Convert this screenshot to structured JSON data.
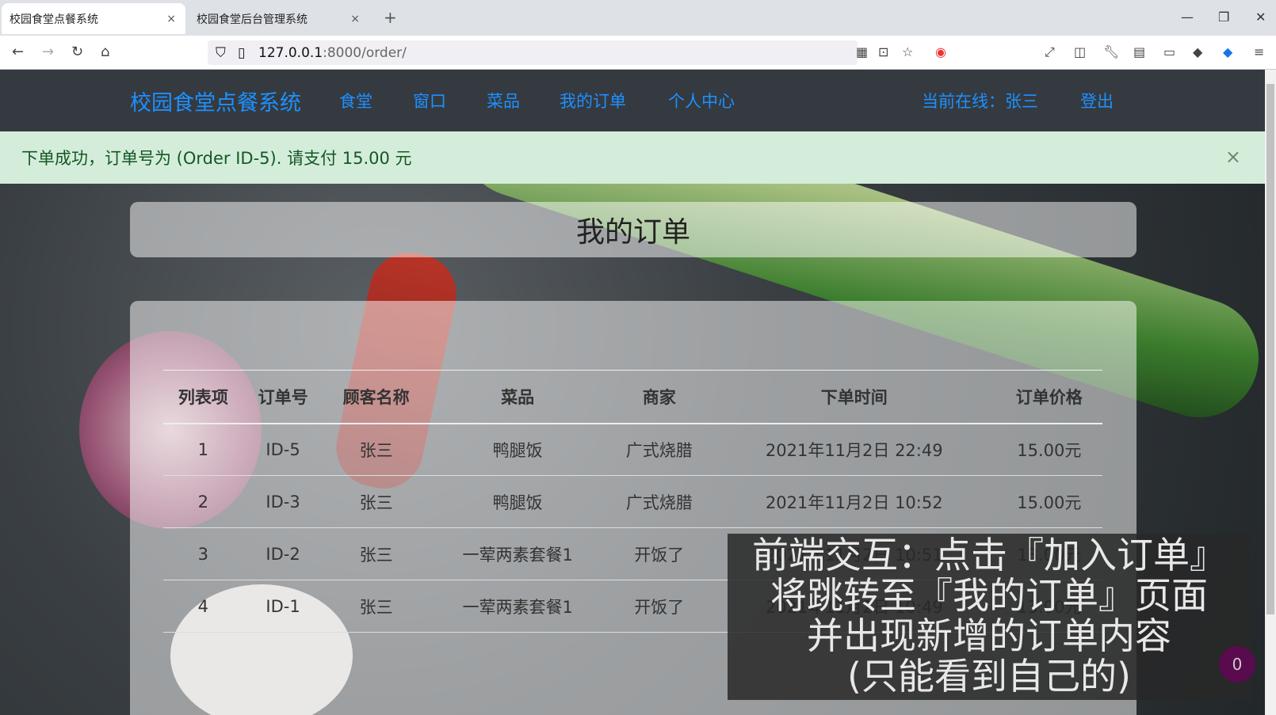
{
  "browser": {
    "tabs": [
      {
        "title": "校园食堂点餐系统",
        "close": "×"
      },
      {
        "title": "校园食堂后台管理系统",
        "close": "×"
      }
    ],
    "new_tab": "+",
    "url_host": "127.0.0.1",
    "url_rest": ":8000/order/"
  },
  "navbar": {
    "brand": "校园食堂点餐系统",
    "links": [
      "食堂",
      "窗口",
      "菜品",
      "我的订单",
      "个人中心"
    ],
    "online": "当前在线：张三",
    "logout": "登出"
  },
  "alert": {
    "message": "下单成功，订单号为 (Order ID-5). 请支付 15.00 元",
    "close": "×"
  },
  "page_title": "我的订单",
  "table": {
    "headers": [
      "列表项",
      "订单号",
      "顾客名称",
      "菜品",
      "商家",
      "下单时间",
      "订单价格"
    ],
    "rows": [
      [
        "1",
        "ID-5",
        "张三",
        "鸭腿饭",
        "广式烧腊",
        "2021年11月2日 22:49",
        "15.00元"
      ],
      [
        "2",
        "ID-3",
        "张三",
        "鸭腿饭",
        "广式烧腊",
        "2021年11月2日 10:52",
        "15.00元"
      ],
      [
        "3",
        "ID-2",
        "张三",
        "一荤两素套餐1",
        "开饭了",
        "2021年11月2日 10:51",
        "13.00元"
      ],
      [
        "4",
        "ID-1",
        "张三",
        "一荤两素套餐1",
        "开饭了",
        "2021年11月2日 10:49",
        "13.00元"
      ]
    ]
  },
  "caption": [
    "前端交互：点击『加入订单』",
    "将跳转至『我的订单』页面",
    "并出现新增的订单内容",
    "(只能看到自己的)"
  ],
  "badge": "0"
}
